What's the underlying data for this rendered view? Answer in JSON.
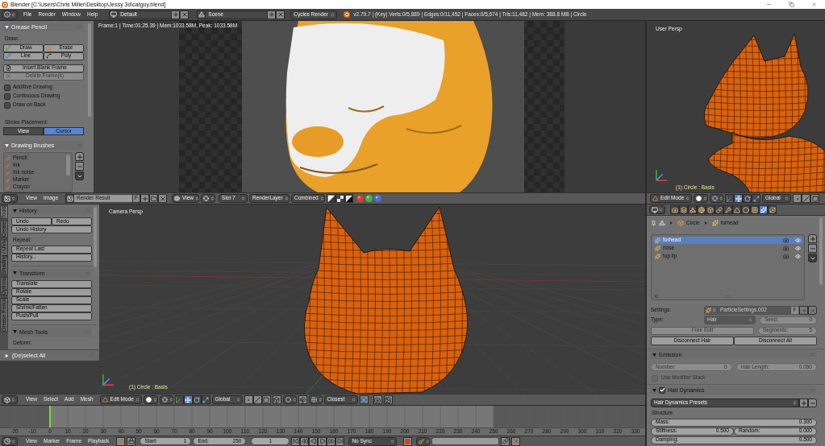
{
  "title_bar": {
    "title": "Blender [C:\\Users\\Chris Miller\\Desktop\\Jessy 3d\\catguy.blend]"
  },
  "info_header": {
    "menus": [
      "File",
      "Render",
      "Window",
      "Help"
    ],
    "layout": "Default",
    "scene": "Scene",
    "engine": "Cycles Render",
    "stats": "v2.79.7 | (Key) Verts:0/5,889 | Edges:0/11,452 | Faces:0/5,674 | Tris:11,482 | Mem: 388.8 MB | Circle"
  },
  "grease_pencil": {
    "title": "Grease Pencil",
    "expanded": true,
    "draw_label": "Draw:",
    "draw_tools": [
      {
        "kind": "draw",
        "label": "Draw"
      },
      {
        "kind": "erase",
        "label": "Erase"
      },
      {
        "kind": "line",
        "label": "Line"
      },
      {
        "kind": "poly",
        "label": "Poly"
      }
    ],
    "frame_buttons": [
      {
        "kind": "insert",
        "label": "Insert Blank Frame",
        "disabled": false
      },
      {
        "kind": "delete",
        "label": "Delete Frame(s)",
        "disabled": true
      }
    ],
    "options": [
      {
        "label": "Additive Drawing",
        "checked": false
      },
      {
        "label": "Continuous Drawing",
        "checked": false
      },
      {
        "label": "Draw on Back",
        "checked": false
      }
    ],
    "placement_label": "Stroke Placement:",
    "placement": [
      {
        "label": "View",
        "selected": false
      },
      {
        "label": "Cursor",
        "selected": true
      }
    ]
  },
  "drawing_brushes": {
    "title": "Drawing Brushes",
    "expanded": true,
    "brushes": [
      "Pencil",
      "Ink",
      "Ink noise",
      "Marker",
      "Crayon"
    ]
  },
  "render_view": {
    "info": "Frame:1 | Time:01:25.39 | Mem:1033.58M, Peak: 1033.58M"
  },
  "image_header": {
    "menus": [
      "View",
      "Image"
    ],
    "image": "Render Result",
    "fake_user": "F",
    "view": "View",
    "slot": "Slot 7",
    "layer": "RenderLayer",
    "pass": "Combined",
    "channels": [
      {
        "kind": "color-alpha",
        "selected": true
      },
      {
        "kind": "alpha",
        "selected": false
      },
      {
        "kind": "z-buffer",
        "selected": false
      }
    ]
  },
  "user_view": {
    "label": "User Persp",
    "object": "(1) Circle : Basis"
  },
  "top_view_header": {
    "mode": "Edit Mode",
    "manipulators": [
      {
        "kind": "axes",
        "selected": false
      },
      {
        "kind": "translate",
        "selected": true
      },
      {
        "kind": "rotate",
        "selected": false
      },
      {
        "kind": "scale",
        "selected": false
      }
    ],
    "orientation": "Global"
  },
  "tool_tabs": [
    {
      "label": "Tools",
      "selected": true
    },
    {
      "label": "Create",
      "selected": false
    },
    {
      "label": "Shading / UVs",
      "selected": false
    },
    {
      "label": "Options",
      "selected": false
    },
    {
      "label": "Grease Pencil",
      "selected": false
    }
  ],
  "history": {
    "title": "History",
    "expanded": true,
    "undo": "Undo",
    "redo": "Redo",
    "undo_history": "Undo History",
    "repeat_label": "Repeat:",
    "repeat_last": "Repeat Last",
    "history": "History..."
  },
  "transform": {
    "title": "Transform",
    "expanded": true,
    "buttons": [
      "Translate",
      "Rotate",
      "Scale",
      "Shrink/Fatten",
      "Push/Pull"
    ]
  },
  "mesh_tools": {
    "title": "Mesh Tools",
    "expanded": true,
    "deform_label": "Deform:"
  },
  "last_operator": {
    "title": "(De)select All",
    "expanded": false
  },
  "camera_view": {
    "label": "Camera Persp",
    "object": "(1) Circle : Basis"
  },
  "bottom_view_header": {
    "menus": [
      "View",
      "Select",
      "Add",
      "Mesh"
    ],
    "mode": "Edit Mode",
    "manipulators": [
      {
        "kind": "axes",
        "selected": false
      },
      {
        "kind": "translate",
        "selected": true
      },
      {
        "kind": "rotate",
        "selected": false
      },
      {
        "kind": "scale",
        "selected": false
      }
    ],
    "orientation": "Global",
    "snap": "Closest"
  },
  "timeline": {
    "frame_labels": [
      "-20",
      "-10",
      "0",
      "10",
      "20",
      "30",
      "40",
      "50",
      "60",
      "70",
      "80",
      "90",
      "100",
      "110",
      "120",
      "130",
      "140",
      "150",
      "160",
      "170",
      "180",
      "190",
      "200",
      "210",
      "220",
      "230",
      "240",
      "250",
      "260",
      "270",
      "280",
      "290",
      "300",
      "310",
      "320",
      "330"
    ]
  },
  "timeline_header": {
    "menus": [
      "View",
      "Marker",
      "Frame",
      "Playback"
    ],
    "start_label": "Start:",
    "start": "1",
    "end_label": "End:",
    "end": "250",
    "current_frame": "1",
    "sync": "No Sync"
  },
  "properties": {
    "context_tabs": [
      {
        "kind": "render",
        "selected": false
      },
      {
        "kind": "layers",
        "selected": false
      },
      {
        "kind": "scene",
        "selected": false
      },
      {
        "kind": "world",
        "selected": false
      },
      {
        "kind": "object",
        "selected": false
      },
      {
        "kind": "constraints",
        "selected": false
      },
      {
        "kind": "modifiers",
        "selected": false
      },
      {
        "kind": "data",
        "selected": false
      },
      {
        "kind": "material",
        "selected": false
      },
      {
        "kind": "texture",
        "selected": false
      },
      {
        "kind": "particles",
        "selected": true
      },
      {
        "kind": "physics",
        "selected": false
      }
    ],
    "breadcrumbs": [
      "Circle",
      "forhead"
    ],
    "particle_systems": [
      {
        "name": "forhead",
        "selected": true
      },
      {
        "name": "nose",
        "selected": false
      },
      {
        "name": "top lip",
        "selected": false
      }
    ],
    "settings": {
      "label": "Settings:",
      "value": "ParticleSettings.002",
      "fake_user": "F",
      "disabled": true
    },
    "type": {
      "label": "Type:",
      "value": "Hair",
      "disabled": true
    },
    "seed": {
      "label": "Seed:",
      "value": "0",
      "disabled": true
    },
    "free_edit": {
      "label": "Free Edit",
      "disabled": true
    },
    "segments": {
      "label": "Segments:",
      "value": "5",
      "disabled": true
    },
    "disconnect": [
      "Disconnect Hair",
      "Disconnect All"
    ],
    "emission": {
      "title": "Emission",
      "expanded": true,
      "number": {
        "label": "Number:",
        "value": "0",
        "disabled": true
      },
      "hair_length": {
        "label": "Hair Length:",
        "value": "0.050",
        "disabled": true
      },
      "use_modifier_stack": {
        "label": "Use Modifier Stack",
        "checked": false,
        "disabled": true
      }
    },
    "hair_dynamics": {
      "title": "Hair Dynamics",
      "checked": true,
      "expanded": true,
      "presets": "Hair Dynamics Presets",
      "structure_label": "Structure",
      "mass": {
        "label": "Mass:",
        "value": "0.300"
      },
      "stiffness": {
        "label": "Stiffness:",
        "value": "0.500"
      },
      "random": {
        "label": "Random:",
        "value": "0.000"
      },
      "damping": {
        "label": "Damping:",
        "value": "0.500"
      }
    }
  }
}
